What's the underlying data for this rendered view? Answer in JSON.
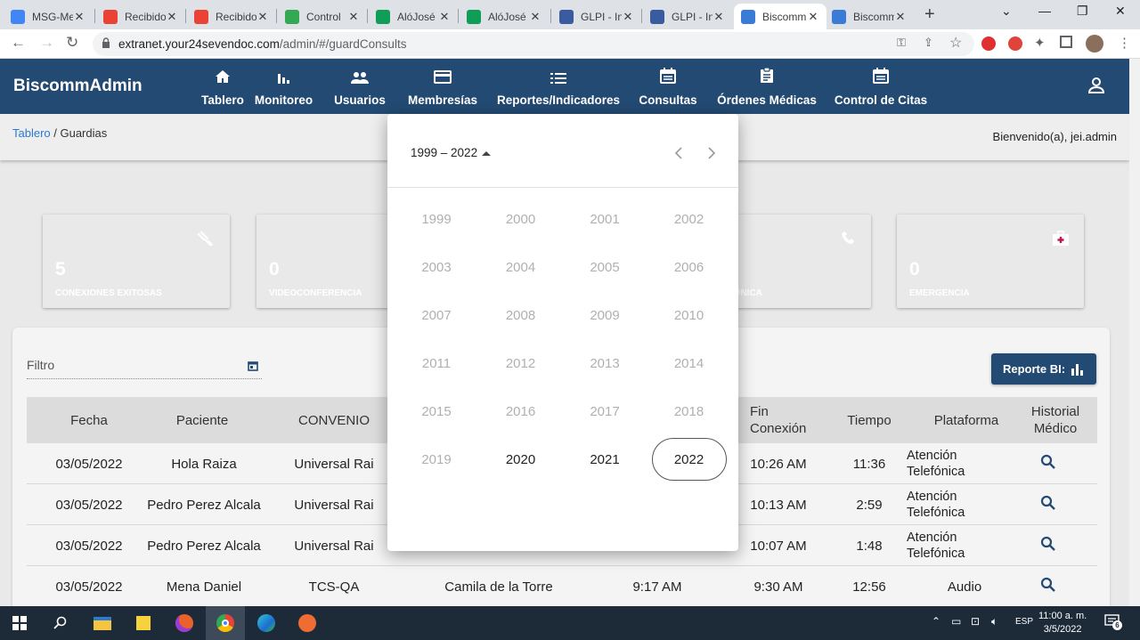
{
  "browser": {
    "tabs": [
      {
        "title": "MSG-Me",
        "icon": "doc-icon",
        "color": "#4285f4"
      },
      {
        "title": "Recibido",
        "icon": "gmail-icon",
        "color": "#ea4335"
      },
      {
        "title": "Recibido",
        "icon": "gmail-icon",
        "color": "#ea4335"
      },
      {
        "title": "Control",
        "icon": "drive-icon",
        "color": "#34a853"
      },
      {
        "title": "AlóJosé",
        "icon": "plus-app-icon",
        "color": "#0f9d58"
      },
      {
        "title": "AlóJosé",
        "icon": "plus-app-icon",
        "color": "#0f9d58"
      },
      {
        "title": "GLPI - In",
        "icon": "glpi-icon",
        "color": "#3a5ba0"
      },
      {
        "title": "GLPI - In",
        "icon": "glpi-icon",
        "color": "#3a5ba0"
      },
      {
        "title": "Biscomm",
        "icon": "biscomm-icon",
        "color": "#3a7bd5"
      },
      {
        "title": "Biscomm",
        "icon": "biscomm-icon",
        "color": "#3a7bd5"
      }
    ],
    "url_host": "extranet.your24sevendoc.com",
    "url_path": "/admin/#/guardConsults"
  },
  "app": {
    "brand": "BiscommAdmin",
    "nav": [
      {
        "label": "Tablero",
        "icon": "home-icon"
      },
      {
        "label": "Monitoreo",
        "icon": "bar-chart-icon"
      },
      {
        "label": "Usuarios",
        "icon": "users-icon"
      },
      {
        "label": "Membresías",
        "icon": "card-icon"
      },
      {
        "label": "Reportes/Indicadores",
        "icon": "list-icon"
      },
      {
        "label": "Consultas",
        "icon": "calendar-icon"
      },
      {
        "label": "Órdenes Médicas",
        "icon": "clipboard-icon"
      },
      {
        "label": "Control de Citas",
        "icon": "calendar-icon"
      }
    ],
    "breadcrumb": {
      "link": "Tablero",
      "sep": " / ",
      "current": "Guardias"
    },
    "welcome": "Bienvenido(a), jei.admin"
  },
  "cards": [
    {
      "value": "5",
      "caption": "CONEXIONES EXITOSAS",
      "color": "#189a77",
      "icon": "connection-icon"
    },
    {
      "value": "0",
      "caption": "VIDEOCONFERENCIA",
      "color": "#6b86c6",
      "icon": ""
    },
    {
      "value": "",
      "caption": "N TELEFÓNICA",
      "color": "#c4462e",
      "icon": "phone-icon"
    },
    {
      "value": "0",
      "caption": "EMERGENCIA",
      "color": "#c0174f",
      "icon": "medkit-icon"
    }
  ],
  "filter": {
    "label": "Filtro"
  },
  "report_button": "Reporte BI:",
  "table": {
    "headers": [
      "Fecha",
      "Paciente",
      "CONVENIO",
      "Fin Conexión",
      "Tiempo",
      "Plataforma",
      "Historial Médico"
    ],
    "rows": [
      {
        "fecha": "03/05/2022",
        "paciente": "Hola Raiza",
        "convenio": "Universal Rai",
        "medico": "",
        "inicio": "",
        "fin": "10:26 AM",
        "tiempo": "11:36",
        "plataforma": "Atención Telefónica"
      },
      {
        "fecha": "03/05/2022",
        "paciente": "Pedro Perez Alcala",
        "convenio": "Universal Rai",
        "medico": "",
        "inicio": "",
        "fin": "10:13 AM",
        "tiempo": "2:59",
        "plataforma": "Atención Telefónica"
      },
      {
        "fecha": "03/05/2022",
        "paciente": "Pedro Perez Alcala",
        "convenio": "Universal Rai",
        "medico": "",
        "inicio": "",
        "fin": "10:07 AM",
        "tiempo": "1:48",
        "plataforma": "Atención Telefónica"
      },
      {
        "fecha": "03/05/2022",
        "paciente": "Mena Daniel",
        "convenio": "TCS-QA",
        "medico": "Camila de la Torre",
        "inicio": "9:17 AM",
        "fin": "9:30 AM",
        "tiempo": "12:56",
        "plataforma": "Audio"
      }
    ]
  },
  "picker": {
    "range": "1999 – 2022",
    "years": [
      "1999",
      "2000",
      "2001",
      "2002",
      "2003",
      "2004",
      "2005",
      "2006",
      "2007",
      "2008",
      "2009",
      "2010",
      "2011",
      "2012",
      "2013",
      "2014",
      "2015",
      "2016",
      "2017",
      "2018",
      "2019",
      "2020",
      "2021",
      "2022"
    ],
    "enabled": [
      "2020",
      "2021",
      "2022"
    ],
    "selected": "2022"
  },
  "taskbar": {
    "lang": "ESP",
    "time": "11:00 a. m.",
    "date": "3/5/2022",
    "notifications": "6"
  }
}
